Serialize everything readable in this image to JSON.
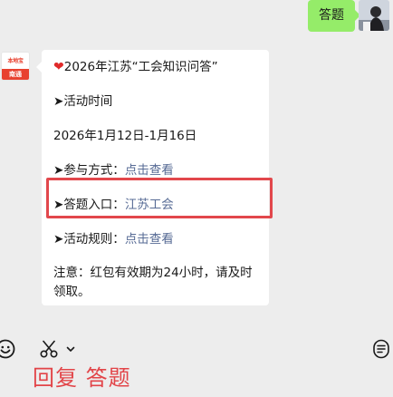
{
  "outgoing": {
    "text": "答题"
  },
  "incoming": {
    "heart_icon": "heart-icon",
    "title": "2026年江苏“工会知识问答”",
    "arrow": "➤",
    "activity_time_label": "活动时间",
    "activity_dates": "2026年1月12日-1月16日",
    "participate_label": "参与方式：",
    "participate_link": "点击查看",
    "entry_label": "答题入口：",
    "entry_link": "江苏工会",
    "rules_label": "活动规则：",
    "rules_link": "点击查看",
    "notice": "注意：红包有效期为24小时，请及时领取。"
  },
  "toolbar": {
    "emoji_icon": "emoji-icon",
    "scissors_icon": "scissors-icon",
    "chevron_icon": "chevron-down-icon",
    "voice_icon": "voice-icon"
  },
  "caption": {
    "text": "回复 答题"
  },
  "colors": {
    "outgoing_bubble": "#95ec69",
    "link": "#576b95",
    "highlight": "#e2474c",
    "caption": "#e24448"
  }
}
